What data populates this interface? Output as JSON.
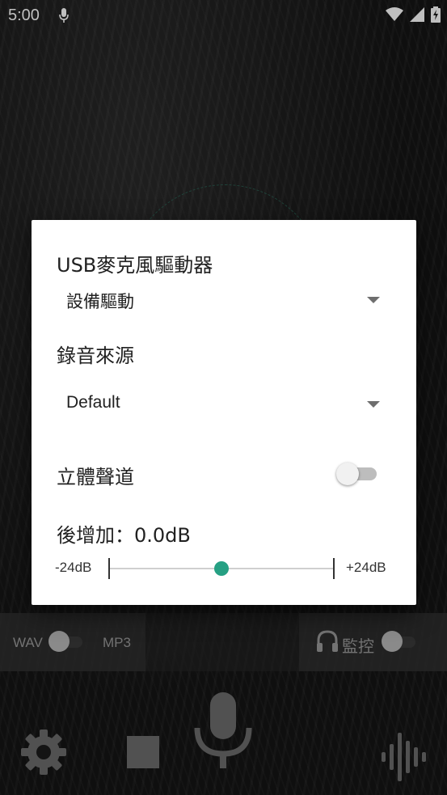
{
  "status_bar": {
    "time": "5:00",
    "icons": [
      "mic-icon",
      "wifi-icon",
      "signal-icon",
      "battery-charging-icon"
    ]
  },
  "dialog": {
    "usb_driver_label": "USB麥克風驅動器",
    "usb_driver_selected": "設備驅動",
    "source_label": "錄音來源",
    "source_selected": "Default",
    "stereo_label": "立體聲道",
    "stereo_on": false,
    "gain_label": "後增加：0.0dB",
    "gain_min_label": "-24dB",
    "gain_max_label": "+24dB",
    "gain_value_db": 0.0,
    "gain_range_db": [
      -24,
      24
    ]
  },
  "format_bar": {
    "wav_label": "WAV",
    "mp3_label": "MP3",
    "monitor_label": "監控",
    "monitor_icon": "headphones-icon"
  },
  "controls": {
    "icons": [
      "settings-gear-icon",
      "stop-icon",
      "microphone-icon",
      "waveform-icon"
    ]
  },
  "colors": {
    "accent": "#26a083",
    "dialog_bg": "#ffffff",
    "background": "#1b1b1b"
  }
}
